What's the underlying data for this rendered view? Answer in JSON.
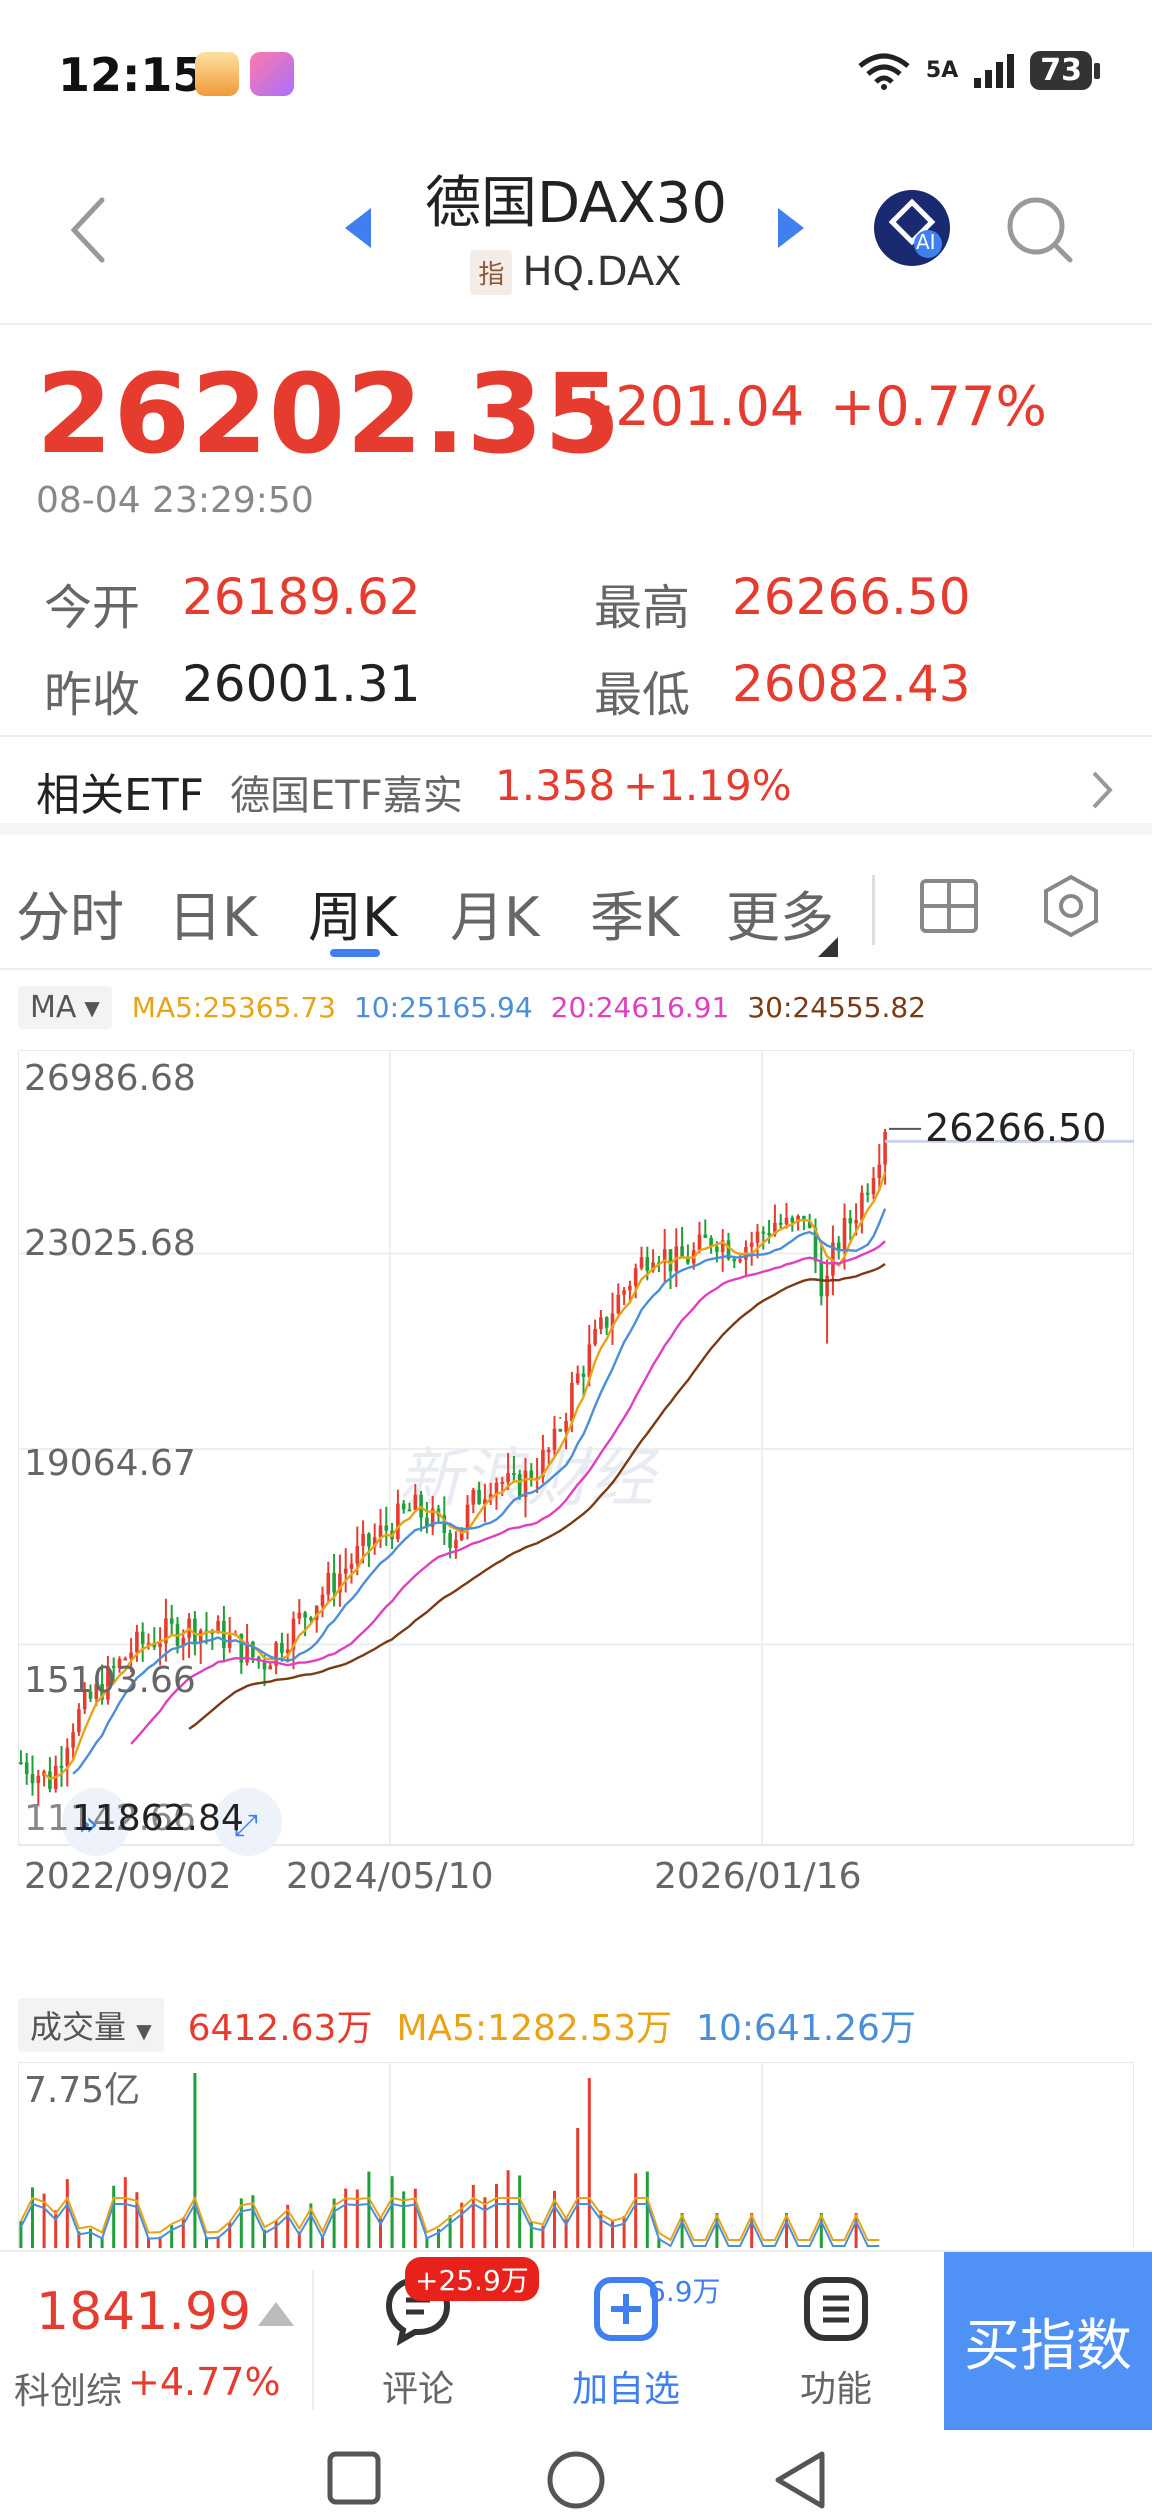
{
  "status_bar": {
    "time": "12:15",
    "signal_left": "6",
    "network_label": "5A",
    "battery": "73"
  },
  "header": {
    "title": "德国DAX30",
    "code_badge": "指",
    "code": "HQ.DAX",
    "ai_label": "AI"
  },
  "quote": {
    "price": "26202.35",
    "change": "+201.04",
    "change_pct": "+0.77%",
    "time": "08-04 23:29:50",
    "open_label": "今开",
    "open": "26189.62",
    "high_label": "最高",
    "high": "26266.50",
    "prev_close_label": "昨收",
    "prev_close": "26001.31",
    "low_label": "最低",
    "low": "26082.43"
  },
  "etf": {
    "title": "相关ETF",
    "name": "德国ETF嘉实",
    "price": "1.358",
    "change_pct": "+1.19%"
  },
  "tabs": [
    "分时",
    "日K",
    "周K",
    "月K",
    "季K",
    "更多"
  ],
  "active_tab": "周K",
  "ma": {
    "selector": "MA",
    "ma5": "MA5:25365.73",
    "ma10": "10:25165.94",
    "ma20": "20:24616.91",
    "ma30": "30:24555.82",
    "colors": {
      "ma5": "#e8a317",
      "ma10": "#4a8fd8",
      "ma20": "#e040c0",
      "ma30": "#7a3b14"
    }
  },
  "chart_data": {
    "type": "candlestick",
    "y_labels": [
      "26986.68",
      "23025.68",
      "19064.67",
      "15103.66",
      "11142.66"
    ],
    "x_labels": [
      "2022/09/02",
      "2024/05/10",
      "2026/01/16"
    ],
    "max_label": "26266.50",
    "min_label": "11862.84",
    "watermark": "新浪财经",
    "ylim": [
      11142.66,
      26986.68
    ],
    "up_color": "#e53c2f",
    "down_color": "#1f9e3a",
    "trend": [
      [
        0,
        12800
      ],
      [
        0.03,
        12400
      ],
      [
        0.05,
        13600
      ],
      [
        0.08,
        14400
      ],
      [
        0.11,
        15200
      ],
      [
        0.14,
        15500
      ],
      [
        0.17,
        15700
      ],
      [
        0.2,
        15500
      ],
      [
        0.22,
        15200
      ],
      [
        0.24,
        14900
      ],
      [
        0.26,
        15400
      ],
      [
        0.28,
        15900
      ],
      [
        0.3,
        16400
      ],
      [
        0.33,
        17100
      ],
      [
        0.36,
        17700
      ],
      [
        0.39,
        18200
      ],
      [
        0.41,
        17900
      ],
      [
        0.43,
        17600
      ],
      [
        0.45,
        18300
      ],
      [
        0.47,
        18900
      ],
      [
        0.49,
        18600
      ],
      [
        0.51,
        19000
      ],
      [
        0.53,
        19500
      ],
      [
        0.55,
        20800
      ],
      [
        0.57,
        21700
      ],
      [
        0.59,
        22500
      ],
      [
        0.61,
        23200
      ],
      [
        0.63,
        23800
      ],
      [
        0.65,
        23400
      ],
      [
        0.67,
        23600
      ],
      [
        0.69,
        24000
      ],
      [
        0.71,
        23700
      ],
      [
        0.73,
        23900
      ],
      [
        0.75,
        24300
      ],
      [
        0.77,
        24100
      ],
      [
        0.78,
        24500
      ],
      [
        0.79,
        23500
      ],
      [
        0.8,
        22800
      ],
      [
        0.81,
        23700
      ],
      [
        0.82,
        24100
      ],
      [
        0.83,
        24500
      ],
      [
        0.84,
        25000
      ],
      [
        0.85,
        25600
      ],
      [
        0.86,
        26200
      ]
    ]
  },
  "volume": {
    "selector": "成交量",
    "value": "6412.63万",
    "ma5": "MA5:1282.53万",
    "ma10": "10:641.26万",
    "max_label": "7.75亿"
  },
  "bottom_bar": {
    "index_price": "1841.99",
    "index_name": "科创综",
    "index_pct": "+4.77%",
    "comment_badge": "+25.9万",
    "comment_label": "评论",
    "watch_badge": "6.9万",
    "watch_label": "加自选",
    "func_label": "功能",
    "buy_label": "买指数"
  }
}
